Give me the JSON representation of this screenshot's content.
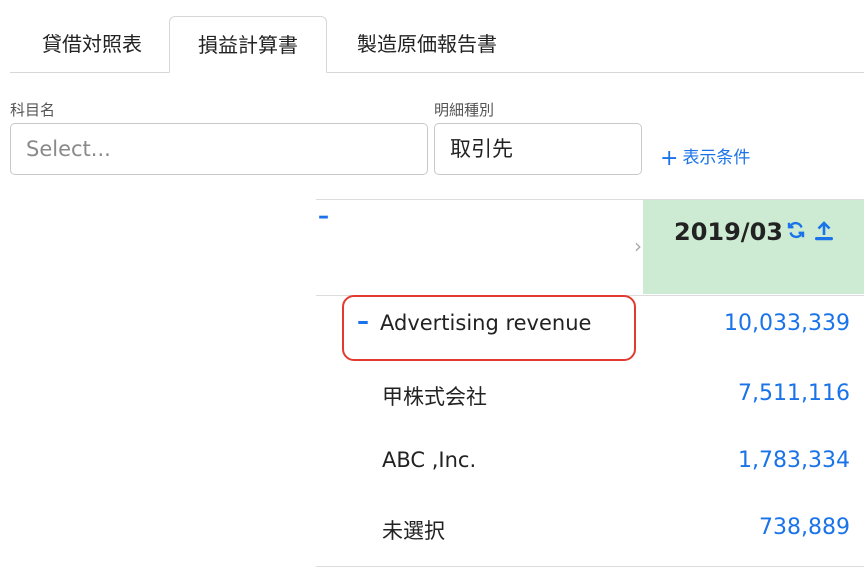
{
  "tabs": [
    {
      "label": "貸借対照表",
      "active": false
    },
    {
      "label": "損益計算書",
      "active": true
    },
    {
      "label": "製造原価報告書",
      "active": false
    }
  ],
  "filters": {
    "subject_label": "科目名",
    "subject_placeholder": "Select...",
    "detail_label": "明細種別",
    "detail_value": "取引先",
    "add_condition": "表示条件"
  },
  "table": {
    "period": "2019/03",
    "group": {
      "label": "Advertising revenue",
      "value": "10,033,339"
    },
    "rows": [
      {
        "label": "甲株式会社",
        "value": "7,511,116"
      },
      {
        "label": "ABC ,Inc.",
        "value": "1,783,334"
      },
      {
        "label": "未選択",
        "value": "738,889"
      }
    ]
  },
  "colors": {
    "accent": "#1a73e8",
    "period_bg": "#cdebd2",
    "highlight": "#e23a2f"
  }
}
